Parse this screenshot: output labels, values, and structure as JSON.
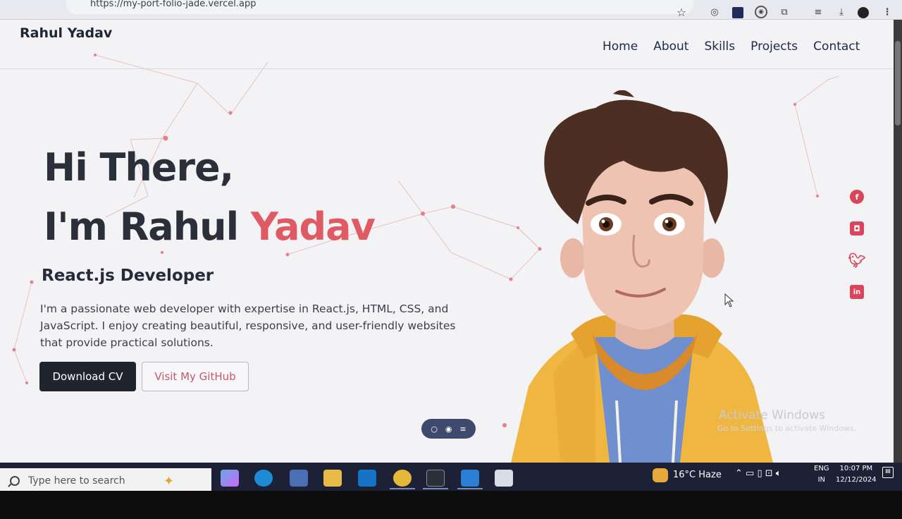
{
  "browser": {
    "url": "https://my-port-folio-jade.vercel.app"
  },
  "navbar": {
    "brand": "Rahul Yadav",
    "links": [
      "Home",
      "About",
      "Skills",
      "Projects",
      "Contact"
    ]
  },
  "hero": {
    "greeting": "Hi There,",
    "intro": "I'm Rahul",
    "name_accent": "Yadav",
    "role": "React.js Developer",
    "description": "I'm a passionate web developer with expertise in React.js, HTML, CSS, and JavaScript. I enjoy creating beautiful, responsive, and user-friendly websites that provide practical solutions.",
    "primary_button": "Download CV",
    "secondary_button": "Visit My GitHub"
  },
  "social": [
    "facebook-icon",
    "instagram-icon",
    "twitter-icon",
    "linkedin-icon"
  ],
  "watermark": {
    "title": "Activate Windows",
    "subtitle": "Go to Settings to activate Windows."
  },
  "taskbar": {
    "search_placeholder": "Type here to search",
    "weather": "16°C  Haze",
    "lang_top": "ENG",
    "lang_bottom": "IN",
    "time": "10:07 PM",
    "date": "12/12/2024"
  },
  "colors": {
    "accent": "#e05a63",
    "dark": "#1f242d",
    "taskbar": "#1c2135"
  }
}
